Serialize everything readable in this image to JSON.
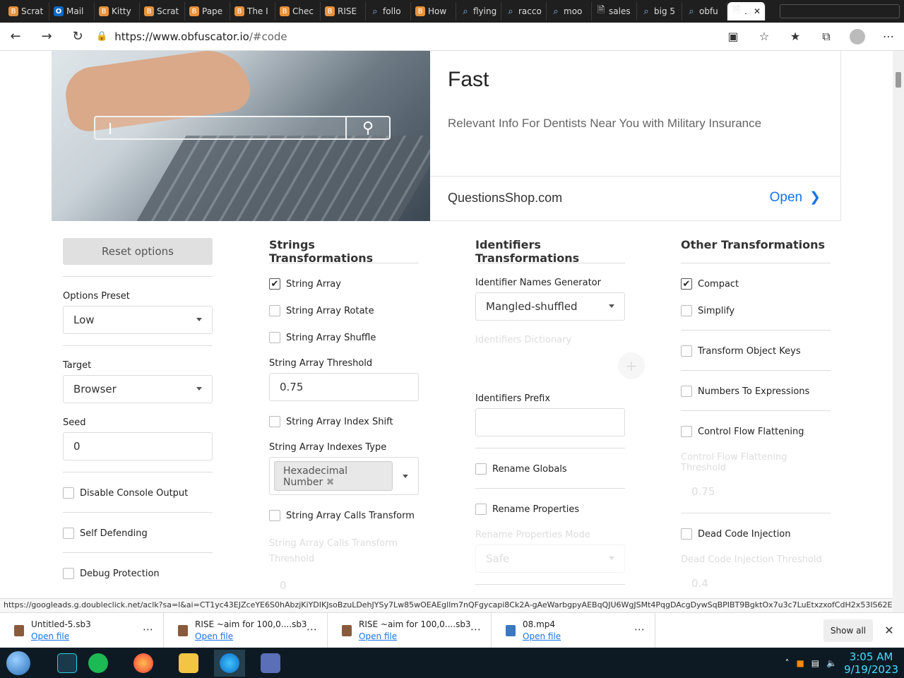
{
  "browser": {
    "tabs": [
      {
        "label": "Scrat",
        "icon": "brave"
      },
      {
        "label": "Mail",
        "icon": "outlook"
      },
      {
        "label": "Kitty",
        "icon": "brave"
      },
      {
        "label": "Scrat",
        "icon": "brave"
      },
      {
        "label": "Pape",
        "icon": "brave"
      },
      {
        "label": "The I",
        "icon": "brave"
      },
      {
        "label": "Chec",
        "icon": "brave"
      },
      {
        "label": "RISE",
        "icon": "brave"
      },
      {
        "label": "follo",
        "icon": "search"
      },
      {
        "label": "How",
        "icon": "brave"
      },
      {
        "label": "flying",
        "icon": "search"
      },
      {
        "label": "racco",
        "icon": "search"
      },
      {
        "label": "moo",
        "icon": "search"
      },
      {
        "label": "sales",
        "icon": "doc"
      },
      {
        "label": "big 5",
        "icon": "search"
      },
      {
        "label": "obfu",
        "icon": "search"
      }
    ],
    "active_tab": {
      "label": ".",
      "icon": "doc"
    },
    "url_domain": "https://www.obfuscator.io",
    "url_path": "/#code"
  },
  "ad": {
    "title": "Fast",
    "description": "Relevant Info For Dentists Near You with Military Insurance",
    "site": "QuestionsShop.com",
    "open_label": "Open"
  },
  "col1": {
    "reset_label": "Reset options",
    "preset_label": "Options Preset",
    "preset_value": "Low",
    "target_label": "Target",
    "target_value": "Browser",
    "seed_label": "Seed",
    "seed_value": "0",
    "disable_console": "Disable Console Output",
    "self_defending": "Self Defending",
    "debug_protection": "Debug Protection"
  },
  "col2": {
    "heading": "Strings Transformations",
    "string_array": "String Array",
    "string_array_checked": true,
    "string_array_rotate": "String Array Rotate",
    "string_array_shuffle": "String Array Shuffle",
    "threshold_label": "String Array Threshold",
    "threshold_value": "0.75",
    "index_shift": "String Array Index Shift",
    "indexes_type_label": "String Array Indexes Type",
    "indexes_type_tag": "Hexadecimal Number",
    "calls_transform": "String Array Calls Transform",
    "calls_transform_threshold_label": "String Array Calls Transform Threshold",
    "calls_transform_threshold_value": "0"
  },
  "col3": {
    "heading": "Identifiers Transformations",
    "generator_label": "Identifier Names Generator",
    "generator_value": "Mangled-shuffled",
    "dictionary_label": "Identifiers Dictionary",
    "prefix_label": "Identifiers Prefix",
    "prefix_value": "",
    "rename_globals": "Rename Globals",
    "rename_properties": "Rename Properties",
    "rename_mode_label": "Rename Properties Mode",
    "rename_mode_value": "Safe"
  },
  "col4": {
    "heading": "Other Transformations",
    "compact": "Compact",
    "compact_checked": true,
    "simplify": "Simplify",
    "transform_object_keys": "Transform Object Keys",
    "numbers_to_expressions": "Numbers To Expressions",
    "control_flow": "Control Flow Flattening",
    "control_flow_threshold_label": "Control Flow Flattening Threshold",
    "control_flow_threshold_value": "0.75",
    "dead_code": "Dead Code Injection",
    "dead_code_threshold_label": "Dead Code Injection Threshold",
    "dead_code_threshold_value": "0.4"
  },
  "status_url": "https://googleads.g.doubleclick.net/aclk?sa=l&ai=CT1yc43EJZceYE6S0hAbzjKiYDIKJsoBzuLDehJYSy7Lw85wOEAEgllm7nQFgycapi8Ck2A-gAeWarbgpyAEBqQJU6WgJSMt4PqgDAcgDywSqBPIBT9BgktOx7u3c7LuEtxzxofCdH2x53IS62E7G...",
  "downloads": [
    {
      "name": "Untitled-5.sb3",
      "action": "Open file",
      "type": "sb3"
    },
    {
      "name": "RISE ~aim for 100,0....sb3",
      "action": "Open file",
      "type": "sb3"
    },
    {
      "name": "RISE ~aim for 100,0....sb3",
      "action": "Open file",
      "type": "sb3"
    },
    {
      "name": "08.mp4",
      "action": "Open file",
      "type": "video"
    }
  ],
  "show_all_label": "Show all",
  "clock": {
    "time": "3:05 AM",
    "date": "9/19/2023"
  }
}
